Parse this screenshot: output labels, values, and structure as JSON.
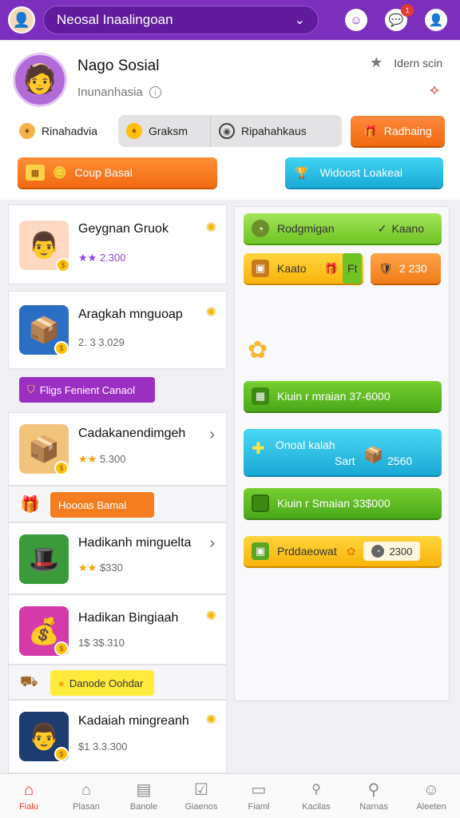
{
  "topbar": {
    "search_text": "Neosal Inaalingoan",
    "avatar_icon": "user-avatar",
    "chat_icon": "chat-bubble-icon",
    "notif_badge": "1",
    "colors": {
      "bar": "#7c2fbc",
      "search": "#5f1c9d"
    }
  },
  "profile": {
    "name": "Nago Sosial",
    "subtitle": "Inunanhasia",
    "right_label": "Idern scin",
    "tabs": [
      {
        "label": "Rinahadvia",
        "icon": "gear-icon"
      },
      {
        "label": "Graksm",
        "icon": "coin-icon"
      },
      {
        "label": "Ripahahkaus",
        "icon": "target-icon"
      }
    ],
    "redeem_label": "Radhaing",
    "coup_label": "Coup Basal",
    "wild_label": "Widoost Loakeai"
  },
  "list": {
    "items": [
      {
        "title": "Geygnan Gruok",
        "meta_stars": "★★",
        "meta_value": "2.300"
      },
      {
        "title": "Aragkah mnguoap",
        "meta_stars": "",
        "meta_value": "2. 3 3.029"
      },
      {
        "title": "Cadakanendimgeh",
        "meta_stars": "★★",
        "meta_value": "5.300"
      },
      {
        "title": "Hadikanh minguelta",
        "meta_stars": "★★",
        "meta_value": "$330"
      },
      {
        "title": "Hadikan Bingiaah",
        "meta_stars": "",
        "meta_value": "1$ 3$.310"
      },
      {
        "title": "Kadaiah mingreanh",
        "meta_stars": "",
        "meta_value": "$1 3.3.300"
      }
    ],
    "tags": {
      "purple": "Fligs Fenient Canaol",
      "orange": "Hoooas Bamal",
      "yellow": "Danode Oohdar"
    }
  },
  "rewards": {
    "top_green_left": "Rodgmigan",
    "top_green_right": "Kaano",
    "yellow_label": "Kaato",
    "yellow_badge": "Ft",
    "orange_value": "2 230",
    "row1": "Kiuin r mraian 37-6000",
    "cyan_title": "Onoal kalah",
    "cyan_sub": "Sart",
    "cyan_value": "2560",
    "row3": "Kiuin r Smaian 33$000",
    "yellow_bottom": "Prddaeowat",
    "yellow_bottom_value": "2300"
  },
  "bottomnav": {
    "items": [
      {
        "label": "Fialu",
        "icon": "home-icon"
      },
      {
        "label": "Plasan",
        "icon": "house-outline-icon"
      },
      {
        "label": "Banole",
        "icon": "calendar-icon"
      },
      {
        "label": "Giaenos",
        "icon": "check-box-icon"
      },
      {
        "label": "Fiaml",
        "icon": "card-icon"
      },
      {
        "label": "Kacilas",
        "icon": "search-small-icon"
      },
      {
        "label": "Narnas",
        "icon": "search-icon"
      },
      {
        "label": "Aleeten",
        "icon": "person-icon"
      }
    ]
  }
}
